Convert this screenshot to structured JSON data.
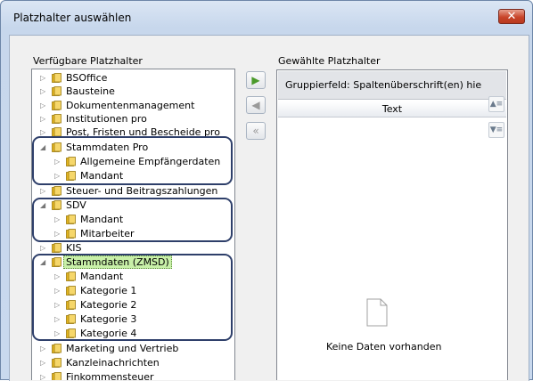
{
  "dialog": {
    "title": "Platzhalter auswählen",
    "close_label": "✕"
  },
  "left": {
    "label": "Verfügbare Platzhalter",
    "items": [
      {
        "label": "BSOffice",
        "level": 0,
        "expanded": false
      },
      {
        "label": "Bausteine",
        "level": 0,
        "expanded": false
      },
      {
        "label": "Dokumentenmanagement",
        "level": 0,
        "expanded": false
      },
      {
        "label": "Institutionen pro",
        "level": 0,
        "expanded": false
      },
      {
        "label": "Post, Fristen und Bescheide pro",
        "level": 0,
        "expanded": false
      },
      {
        "label": "Stammdaten Pro",
        "level": 0,
        "expanded": true
      },
      {
        "label": "Allgemeine Empfängerdaten",
        "level": 1,
        "expanded": false
      },
      {
        "label": "Mandant",
        "level": 1,
        "expanded": false
      },
      {
        "label": "Steuer- und Beitragszahlungen",
        "level": 0,
        "expanded": false
      },
      {
        "label": "SDV",
        "level": 0,
        "expanded": true
      },
      {
        "label": "Mandant",
        "level": 1,
        "expanded": false
      },
      {
        "label": "Mitarbeiter",
        "level": 1,
        "expanded": false
      },
      {
        "label": "KIS",
        "level": 0,
        "expanded": false
      },
      {
        "label": "Stammdaten (ZMSD)",
        "level": 0,
        "expanded": true,
        "selected": true
      },
      {
        "label": "Mandant",
        "level": 1,
        "expanded": false
      },
      {
        "label": "Kategorie 1",
        "level": 1,
        "expanded": false
      },
      {
        "label": "Kategorie 2",
        "level": 1,
        "expanded": false
      },
      {
        "label": "Kategorie 3",
        "level": 1,
        "expanded": false
      },
      {
        "label": "Kategorie 4",
        "level": 1,
        "expanded": false
      },
      {
        "label": "Marketing und Vertrieb",
        "level": 0,
        "expanded": false
      },
      {
        "label": "Kanzleinachrichten",
        "level": 0,
        "expanded": false
      },
      {
        "label": "Finkommensteuer",
        "level": 0,
        "expanded": false
      }
    ]
  },
  "buttons": {
    "add": "▶",
    "remove": "◀",
    "remove_all": "«",
    "move_up": "▲≡",
    "move_down": "▼≡"
  },
  "right": {
    "label": "Gewählte Platzhalter",
    "group_field": "Gruppierfeld: Spaltenüberschrift(en) hie",
    "column": "Text",
    "empty_text": "Keine Daten vorhanden"
  },
  "colors": {
    "folder": "#e8b820",
    "selected_bg": "#c8f0a8",
    "highlight_border": "#2e3f6a"
  }
}
